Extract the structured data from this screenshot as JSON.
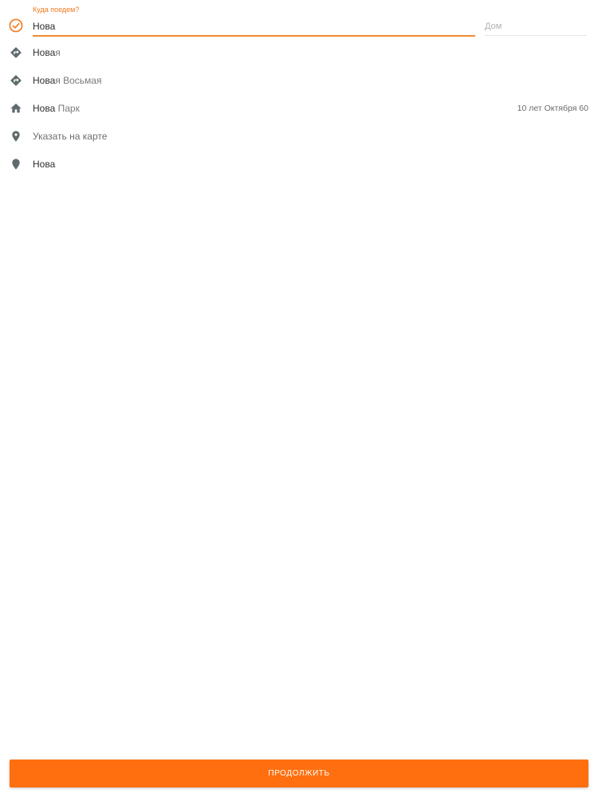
{
  "colors": {
    "accent": "#ff6f0f",
    "icon": "#5f6b6d",
    "label": "#f07a1e"
  },
  "search": {
    "label": "Куда поедем?",
    "value": "Нова",
    "house_placeholder": "Дом",
    "status_icon": "check-circle-icon"
  },
  "suggestions": [
    {
      "icon": "directions-icon",
      "match": "Нова",
      "rest": "я",
      "right": ""
    },
    {
      "icon": "directions-icon",
      "match": "Нова",
      "rest": "я Восьмая",
      "right": ""
    },
    {
      "icon": "home-icon",
      "match": "Нова",
      "rest": " Парк",
      "right": "10 лет Октября 60"
    },
    {
      "icon": "map-pin-icon",
      "match": "",
      "rest": "Указать на карте",
      "right": ""
    },
    {
      "icon": "map-pin-icon",
      "match": "Нова",
      "rest": "",
      "right": ""
    }
  ],
  "footer": {
    "continue_label": "ПРОДОЛЖИТЬ"
  }
}
